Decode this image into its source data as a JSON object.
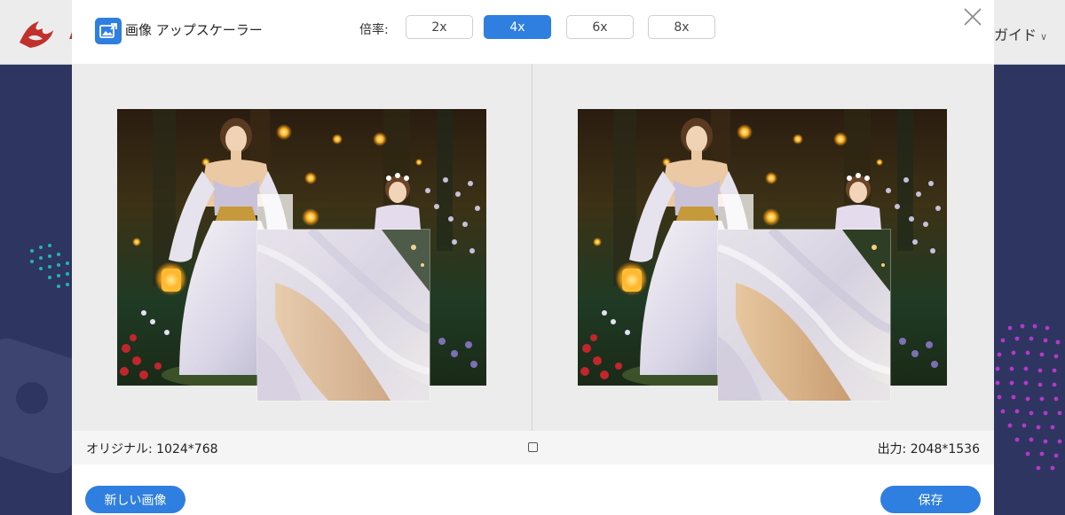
{
  "background_app": {
    "guide_label": "ガイド",
    "logo_letter": "A"
  },
  "modal": {
    "title": "画像 アップスケーラー",
    "scale_label": "倍率:",
    "scale_options": [
      "2x",
      "4x",
      "6x",
      "8x"
    ],
    "selected_scale": "4x",
    "original_size": "オリジナル: 1024*768",
    "output_size": "出力: 2048*1536",
    "new_image_button": "新しい画像",
    "save_button": "保存"
  },
  "colors": {
    "accent": "#2f7fe0",
    "logo_red": "#c0302d",
    "compare_bg": "#ececec"
  },
  "icons": {
    "title": "image-upscale-icon",
    "close": "close-icon",
    "fit": "fit-screen-icon",
    "guide_chevron": "chevron-down-icon",
    "logo": "brand-logo-icon"
  }
}
